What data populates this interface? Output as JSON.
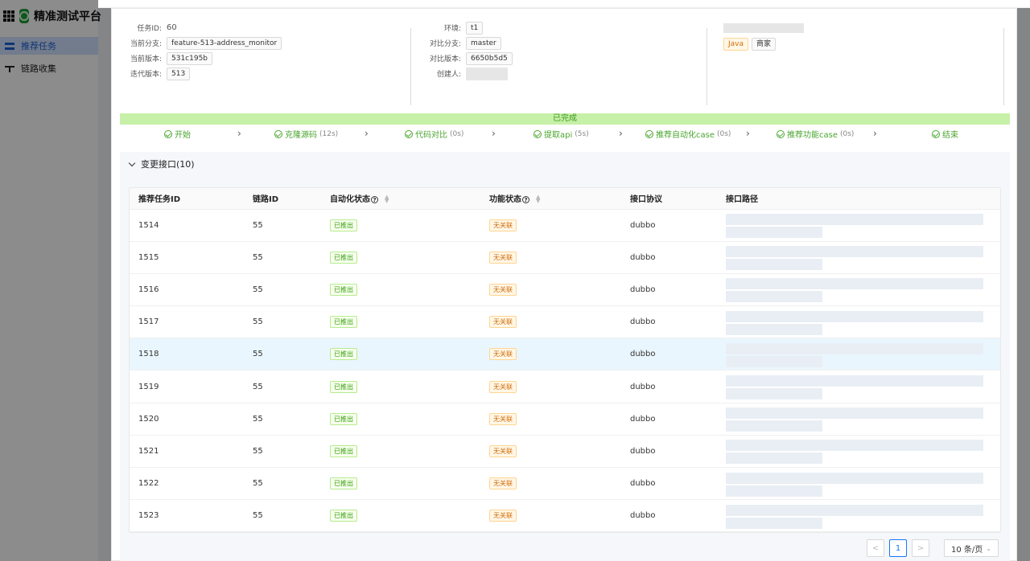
{
  "app": {
    "title": "精准测试平台"
  },
  "sidebar": {
    "items": [
      {
        "label": "推荐任务",
        "active": true
      },
      {
        "label": "链路收集",
        "active": false
      }
    ]
  },
  "info": {
    "task_id_label": "任务ID:",
    "task_id": "60",
    "cur_branch_label": "当前分支:",
    "cur_branch": "feature-513-address_monitor",
    "cur_version_label": "当前版本:",
    "cur_version": "531c195b",
    "iter_version_label": "迭代版本:",
    "iter_version": "513",
    "env_label": "环境:",
    "env": "t1",
    "cmp_branch_label": "对比分支:",
    "cmp_branch": "master",
    "cmp_version_label": "对比版本:",
    "cmp_version": "6650b5d5",
    "creator_label": "创建人:",
    "tags": [
      "Java",
      "商家"
    ]
  },
  "progress": {
    "status": "已完成",
    "steps": [
      {
        "label": "开始",
        "dur": ""
      },
      {
        "label": "克隆源码",
        "dur": "(12s)"
      },
      {
        "label": "代码对比",
        "dur": "(0s)"
      },
      {
        "label": "提取api",
        "dur": "(5s)"
      },
      {
        "label": "推荐自动化case",
        "dur": "(0s)"
      },
      {
        "label": "推荐功能case",
        "dur": "(0s)"
      },
      {
        "label": "结束",
        "dur": ""
      }
    ]
  },
  "section": {
    "title": "变更接口(10)"
  },
  "table": {
    "headers": {
      "task_id": "推荐任务ID",
      "chain_id": "链路ID",
      "auto_status": "自动化状态",
      "func_status": "功能状态",
      "protocol": "接口协议",
      "path": "接口路径"
    },
    "rows": [
      {
        "task_id": "1514",
        "chain_id": "55",
        "auto": "已推出",
        "func": "无关联",
        "protocol": "dubbo"
      },
      {
        "task_id": "1515",
        "chain_id": "55",
        "auto": "已推出",
        "func": "无关联",
        "protocol": "dubbo"
      },
      {
        "task_id": "1516",
        "chain_id": "55",
        "auto": "已推出",
        "func": "无关联",
        "protocol": "dubbo"
      },
      {
        "task_id": "1517",
        "chain_id": "55",
        "auto": "已推出",
        "func": "无关联",
        "protocol": "dubbo"
      },
      {
        "task_id": "1518",
        "chain_id": "55",
        "auto": "已推出",
        "func": "无关联",
        "protocol": "dubbo"
      },
      {
        "task_id": "1519",
        "chain_id": "55",
        "auto": "已推出",
        "func": "无关联",
        "protocol": "dubbo"
      },
      {
        "task_id": "1520",
        "chain_id": "55",
        "auto": "已推出",
        "func": "无关联",
        "protocol": "dubbo"
      },
      {
        "task_id": "1521",
        "chain_id": "55",
        "auto": "已推出",
        "func": "无关联",
        "protocol": "dubbo"
      },
      {
        "task_id": "1522",
        "chain_id": "55",
        "auto": "已推出",
        "func": "无关联",
        "protocol": "dubbo"
      },
      {
        "task_id": "1523",
        "chain_id": "55",
        "auto": "已推出",
        "func": "无关联",
        "protocol": "dubbo"
      }
    ]
  },
  "pager": {
    "prev": "<",
    "current": "1",
    "next": ">",
    "size": "10 条/页"
  },
  "colors": {
    "accent": "#1677ff",
    "success": "#4aa52e",
    "warning": "#d46b08"
  }
}
